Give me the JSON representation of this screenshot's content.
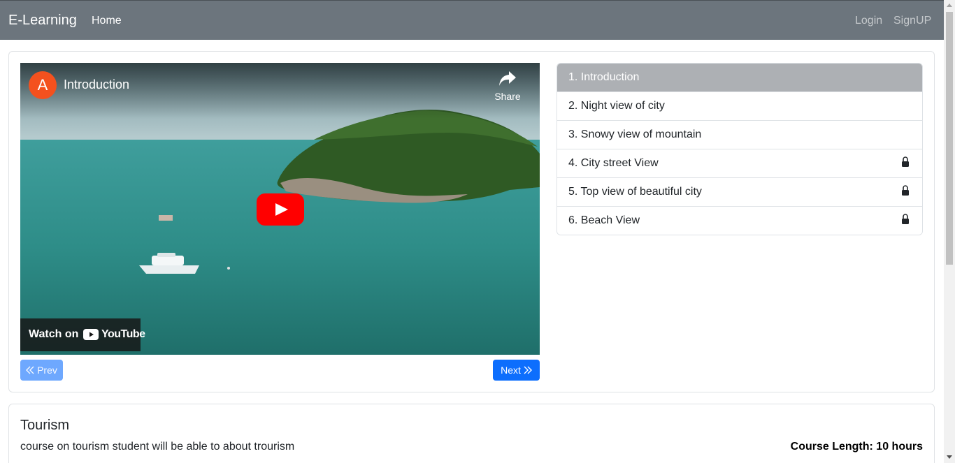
{
  "navbar": {
    "brand": "E-Learning",
    "home_label": "Home",
    "login_label": "Login",
    "signup_label": "SignUP"
  },
  "video": {
    "channel_initial": "A",
    "title": "Introduction",
    "share_label": "Share",
    "watch_on_label": "Watch on",
    "youtube_label": "YouTube",
    "icons": [
      "share-icon",
      "play-icon",
      "youtube-logo-icon"
    ]
  },
  "controls": {
    "prev_label": "Prev",
    "next_label": "Next",
    "prev_icon": "double-chevron-left-icon",
    "next_icon": "double-chevron-right-icon"
  },
  "lessons": [
    {
      "label": "1. Introduction",
      "active": true,
      "locked": false
    },
    {
      "label": "2. Night view of city",
      "active": false,
      "locked": false
    },
    {
      "label": "3. Snowy view of mountain",
      "active": false,
      "locked": false
    },
    {
      "label": "4. City street View",
      "active": false,
      "locked": true
    },
    {
      "label": "5. Top view of beautiful city",
      "active": false,
      "locked": true
    },
    {
      "label": "6. Beach View",
      "active": false,
      "locked": true
    }
  ],
  "course": {
    "title": "Tourism",
    "description": "course on tourism student will be able to about trourism",
    "length_label": "Course Length: 10 hours"
  },
  "colors": {
    "navbar_bg": "#6c757d",
    "primary": "#0d6efd",
    "primary_disabled": "#6ea8fe",
    "active_lesson_bg": "#adb0b4",
    "youtube_red": "#ff0000",
    "avatar": "#f4511e"
  }
}
